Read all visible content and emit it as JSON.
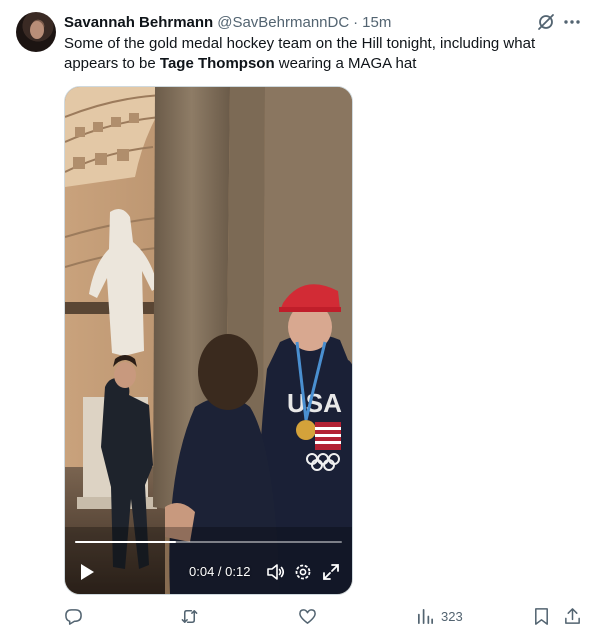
{
  "tweet": {
    "author_name": "Savannah Behrmann",
    "author_handle": "@SavBehrmannDC",
    "separator": "·",
    "timestamp": "15m",
    "text_part1": "Some of the gold medal hockey team on the Hill tonight, including what appears to be ",
    "text_bold": "Tage Thompson",
    "text_part2": " wearing a MAGA hat"
  },
  "video": {
    "time_display": "0:04 / 0:12",
    "progress_fraction": 0.38,
    "icons": [
      "play-icon",
      "volume-icon",
      "settings-icon",
      "fullscreen-icon"
    ]
  },
  "actions": {
    "reply_icon": "reply-icon",
    "retweet_icon": "retweet-icon",
    "like_icon": "like-icon",
    "views_icon": "views-icon",
    "views_count": "323",
    "bookmark_icon": "bookmark-icon",
    "share_icon": "share-icon"
  },
  "colors": {
    "text_primary": "#0f1419",
    "text_secondary": "#536471",
    "icon_gray": "#536471"
  }
}
